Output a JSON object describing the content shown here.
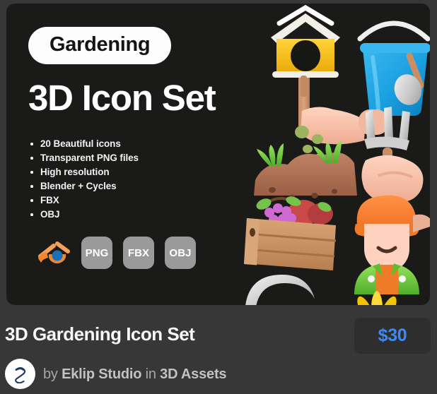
{
  "theme": {
    "page_background": "#373737",
    "hero_background": "#1a1a19",
    "accent_price": "#3d8bf2",
    "badge_background": "#9a9a9a",
    "pill_background": "#fdfdfd"
  },
  "hero": {
    "category_tag": "Gardening",
    "title": "3D Icon Set",
    "features": [
      "20 Beautiful icons",
      "Transparent PNG files",
      "High resolution",
      "Blender + Cycles",
      "FBX",
      "OBJ"
    ],
    "formats": {
      "software_icon": "blender-icon",
      "badges": [
        "PNG",
        "FBX",
        "OBJ"
      ]
    },
    "artwork": {
      "alt": "3D gardening icon set preview",
      "items": [
        "birdhouse-icon",
        "water-bucket-icon",
        "hand-sowing-seeds-icon",
        "hand-with-garden-fork-icon",
        "fruit-crate-icon",
        "gardener-character-icon",
        "sickle-icon",
        "sunflower-icon"
      ]
    }
  },
  "footer": {
    "product_title": "3D Gardening Icon Set",
    "price": "$30",
    "author": {
      "avatar_icon": "eklip-studio-logo-icon",
      "by_label": "by",
      "studio_name": "Eklip Studio",
      "in_label": "in",
      "category_name": "3D Assets"
    }
  }
}
